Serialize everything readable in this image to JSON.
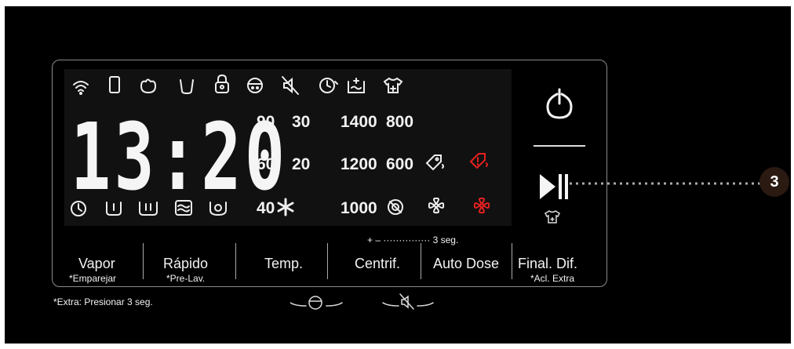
{
  "display": {
    "clock": "13:20",
    "temperatures": [
      "90",
      "30",
      "60",
      "20",
      "40"
    ],
    "spins": [
      "1400",
      "800",
      "1200",
      "600",
      "1000"
    ]
  },
  "buttons": {
    "vapor": {
      "label": "Vapor",
      "sub": "*Emparejar"
    },
    "rapido": {
      "label": "Rápido",
      "sub": "*Pre-Lav."
    },
    "temp": {
      "label": "Temp."
    },
    "centrif": {
      "label": "Centrif."
    },
    "autodose": {
      "label": "Auto Dose"
    },
    "finaldif": {
      "label": "Final. Dif.",
      "sub": "*Acl. Extra"
    }
  },
  "hints": {
    "extra": "*Extra: Presionar 3 seg.",
    "plusminus": "+ – ··············· 3 seg."
  },
  "callout": {
    "number": "3"
  },
  "colors": {
    "background": "#000000",
    "lcd": "#111111",
    "text": "#f2f2f2",
    "alert": "#e52020",
    "callout": "#2a1a12"
  },
  "icons": [
    "wifi-icon",
    "phone-icon",
    "hand-wash-icon",
    "bucket-icon",
    "lock-icon",
    "child-lock-icon",
    "mute-icon",
    "delay-timer-icon",
    "rinse-plus-icon",
    "shirt-plus-icon",
    "clock-icon",
    "tub1-icon",
    "tub2-icon",
    "wave-icon",
    "drum-icon",
    "snowflake-icon",
    "no-spin-icon",
    "tag-icon",
    "tag-alert-icon",
    "fan-icon",
    "fan-alert-icon",
    "power-icon",
    "play-pause-icon",
    "shirt-icon"
  ]
}
